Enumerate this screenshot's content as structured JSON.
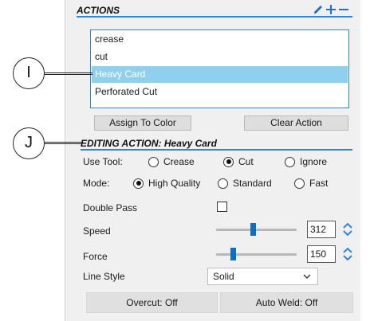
{
  "actions": {
    "title": "ACTIONS",
    "icons": [
      "pencil-icon",
      "plus-icon",
      "minus-icon"
    ],
    "list_items": [
      "crease",
      "cut",
      "Heavy Card",
      "Perforated Cut"
    ],
    "selected_index": 2,
    "assign_button": "Assign To Color",
    "clear_button": "Clear Action"
  },
  "callouts": {
    "i": "I",
    "j": "J"
  },
  "editing": {
    "title": "EDITING ACTION: Heavy Card",
    "use_tool_label": "Use Tool:",
    "tool_options": [
      "Crease",
      "Cut",
      "Ignore"
    ],
    "tool_selected": "Cut",
    "mode_label": "Mode:",
    "mode_options": [
      "High Quality",
      "Standard",
      "Fast"
    ],
    "mode_selected": "High Quality",
    "double_pass_label": "Double Pass",
    "double_pass_checked": false,
    "speed_label": "Speed",
    "speed_value": "312",
    "force_label": "Force",
    "force_value": "150",
    "line_style_label": "Line Style",
    "line_style_value": "Solid",
    "overcut_button": "Overcut: Off",
    "autoweld_button": "Auto Weld: Off"
  },
  "colors": {
    "accent": "#2a88d8",
    "selection": "#8fd0ee",
    "slider_thumb": "#0a6fc7"
  }
}
